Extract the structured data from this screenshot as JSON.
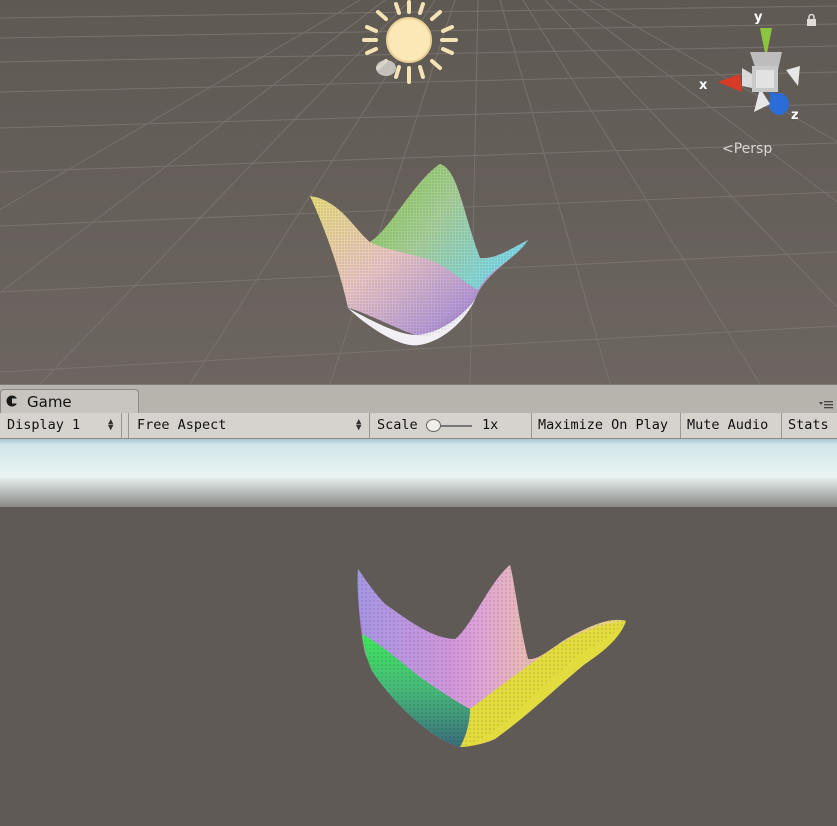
{
  "scene": {
    "axis_x": "x",
    "axis_y": "y",
    "axis_z": "z",
    "projection_label": "Persp",
    "icons": [
      "sun-light-icon",
      "orientation-gizmo-icon",
      "lock-icon"
    ]
  },
  "game_panel": {
    "tab_label": "Game",
    "toolbar": {
      "display": "Display 1",
      "aspect": "Free Aspect",
      "scale_label": "Scale",
      "scale_value": "1x",
      "scale_fraction": 0.0,
      "maximize": "Maximize On Play",
      "mute": "Mute Audio",
      "stats": "Stats"
    }
  },
  "colors": {
    "scene_bg": "#6a635e",
    "game_bg": "#5f5a55",
    "toolbar_bg": "#d6d3cf",
    "gizmo_x": "#d93a25",
    "gizmo_y": "#8cc63f",
    "gizmo_z": "#2a6dd8"
  }
}
